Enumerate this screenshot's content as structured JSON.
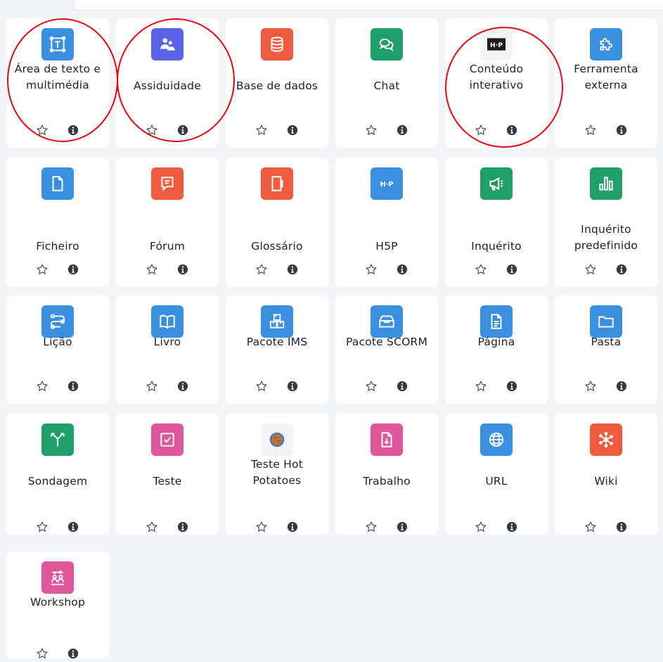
{
  "colors": {
    "blue": "#3a8fe0",
    "indigo": "#5b63e8",
    "red": "#f05a3f",
    "green": "#1e9e68",
    "pink": "#e0569a",
    "annotation": "#e30613"
  },
  "activities": [
    {
      "label": "Área de texto e multimédia",
      "icon": "text-area-icon",
      "color": "blue"
    },
    {
      "label": "Assiduidade",
      "icon": "attendance-icon",
      "color": "indigo"
    },
    {
      "label": "Base de dados",
      "icon": "database-icon",
      "color": "red"
    },
    {
      "label": "Chat",
      "icon": "chat-icon",
      "color": "green"
    },
    {
      "label": "Conteúdo interativo",
      "icon": "h5p-logo-icon",
      "color": "dark"
    },
    {
      "label": "Ferramenta externa",
      "icon": "puzzle-icon",
      "color": "blue"
    },
    {
      "label": "Ficheiro",
      "icon": "file-icon",
      "color": "blue"
    },
    {
      "label": "Fórum",
      "icon": "forum-icon",
      "color": "red"
    },
    {
      "label": "Glossário",
      "icon": "glossary-icon",
      "color": "red"
    },
    {
      "label": "H5P",
      "icon": "h5p-icon",
      "color": "blue"
    },
    {
      "label": "Inquérito",
      "icon": "megaphone-icon",
      "color": "green"
    },
    {
      "label": "Inquérito predefinido",
      "icon": "bar-chart-icon",
      "color": "green"
    },
    {
      "label": "Lição",
      "icon": "lesson-icon",
      "color": "blue"
    },
    {
      "label": "Livro",
      "icon": "book-icon",
      "color": "blue"
    },
    {
      "label": "Pacote IMS",
      "icon": "ims-package-icon",
      "color": "blue"
    },
    {
      "label": "Pacote SCORM",
      "icon": "scorm-package-icon",
      "color": "blue"
    },
    {
      "label": "Página",
      "icon": "page-icon",
      "color": "blue"
    },
    {
      "label": "Pasta",
      "icon": "folder-icon",
      "color": "blue"
    },
    {
      "label": "Sondagem",
      "icon": "choice-icon",
      "color": "green"
    },
    {
      "label": "Teste",
      "icon": "quiz-icon",
      "color": "pink"
    },
    {
      "label": "Teste Hot Potatoes",
      "icon": "hot-potatoes-icon",
      "color": "plain"
    },
    {
      "label": "Trabalho",
      "icon": "assignment-icon",
      "color": "pink"
    },
    {
      "label": "URL",
      "icon": "globe-icon",
      "color": "blue"
    },
    {
      "label": "Wiki",
      "icon": "wiki-icon",
      "color": "red"
    },
    {
      "label": "Workshop",
      "icon": "workshop-icon",
      "color": "pink"
    }
  ],
  "highlighted": [
    "Área de texto e multimédia",
    "Assiduidade",
    "Conteúdo interativo"
  ]
}
